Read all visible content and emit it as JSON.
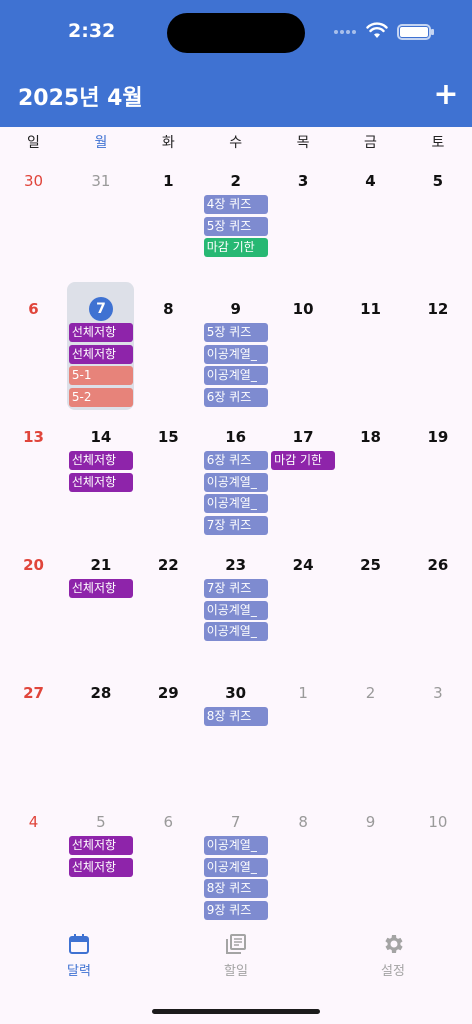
{
  "status": {
    "time": "2:32"
  },
  "header": {
    "title": "2025년 4월",
    "add_label": "+"
  },
  "weekdays": [
    "일",
    "월",
    "화",
    "수",
    "목",
    "금",
    "토"
  ],
  "colors": {
    "quiz": "#7e8bd0",
    "purple": "#8e24aa",
    "green": "#27b873",
    "salmon": "#e7837a",
    "accent": "#3f72d2",
    "sunday": "#e0453b"
  },
  "weeks": [
    {
      "days": [
        {
          "n": "30",
          "other": true,
          "events": []
        },
        {
          "n": "31",
          "other": true,
          "events": []
        },
        {
          "n": "1",
          "events": []
        },
        {
          "n": "2",
          "events": [
            {
              "t": "4장 퀴즈",
              "c": "quiz"
            },
            {
              "t": "5장 퀴즈",
              "c": "quiz"
            },
            {
              "t": "마감 기한",
              "c": "green"
            }
          ]
        },
        {
          "n": "3",
          "events": []
        },
        {
          "n": "4",
          "events": []
        },
        {
          "n": "5",
          "events": []
        }
      ]
    },
    {
      "days": [
        {
          "n": "6",
          "events": []
        },
        {
          "n": "7",
          "today": true,
          "events": [
            {
              "t": "선체저항",
              "c": "purple"
            },
            {
              "t": "선체저항",
              "c": "purple"
            },
            {
              "t": "5-1",
              "c": "salmon"
            },
            {
              "t": "5-2",
              "c": "salmon"
            }
          ]
        },
        {
          "n": "8",
          "events": []
        },
        {
          "n": "9",
          "events": [
            {
              "t": "5장 퀴즈",
              "c": "quiz"
            },
            {
              "t": "이공계열_",
              "c": "quiz"
            },
            {
              "t": "이공계열_",
              "c": "quiz"
            },
            {
              "t": "6장 퀴즈",
              "c": "quiz"
            }
          ]
        },
        {
          "n": "10",
          "events": []
        },
        {
          "n": "11",
          "events": []
        },
        {
          "n": "12",
          "events": []
        }
      ]
    },
    {
      "days": [
        {
          "n": "13",
          "events": []
        },
        {
          "n": "14",
          "events": [
            {
              "t": "선체저항",
              "c": "purple"
            },
            {
              "t": "선체저항",
              "c": "purple"
            }
          ]
        },
        {
          "n": "15",
          "events": []
        },
        {
          "n": "16",
          "events": [
            {
              "t": "6장 퀴즈",
              "c": "quiz"
            },
            {
              "t": "이공계열_",
              "c": "quiz"
            },
            {
              "t": "이공계열_",
              "c": "quiz"
            },
            {
              "t": "7장 퀴즈",
              "c": "quiz"
            }
          ]
        },
        {
          "n": "17",
          "events": [
            {
              "t": "마감 기한",
              "c": "purple"
            }
          ]
        },
        {
          "n": "18",
          "events": []
        },
        {
          "n": "19",
          "events": []
        }
      ]
    },
    {
      "days": [
        {
          "n": "20",
          "events": []
        },
        {
          "n": "21",
          "events": [
            {
              "t": "선체저항",
              "c": "purple"
            }
          ]
        },
        {
          "n": "22",
          "events": []
        },
        {
          "n": "23",
          "events": [
            {
              "t": "7장 퀴즈",
              "c": "quiz"
            },
            {
              "t": "이공계열_",
              "c": "quiz"
            },
            {
              "t": "이공계열_",
              "c": "quiz"
            }
          ]
        },
        {
          "n": "24",
          "events": []
        },
        {
          "n": "25",
          "events": []
        },
        {
          "n": "26",
          "events": []
        }
      ]
    },
    {
      "days": [
        {
          "n": "27",
          "events": []
        },
        {
          "n": "28",
          "events": []
        },
        {
          "n": "29",
          "events": []
        },
        {
          "n": "30",
          "events": [
            {
              "t": "8장 퀴즈",
              "c": "quiz"
            }
          ]
        },
        {
          "n": "1",
          "other": true,
          "events": []
        },
        {
          "n": "2",
          "other": true,
          "events": []
        },
        {
          "n": "3",
          "other": true,
          "events": []
        }
      ]
    },
    {
      "days": [
        {
          "n": "4",
          "other": true,
          "events": []
        },
        {
          "n": "5",
          "other": true,
          "events": [
            {
              "t": "선체저항",
              "c": "purple"
            },
            {
              "t": "선체저항",
              "c": "purple"
            }
          ]
        },
        {
          "n": "6",
          "other": true,
          "events": []
        },
        {
          "n": "7",
          "other": true,
          "events": [
            {
              "t": "이공계열_",
              "c": "quiz"
            },
            {
              "t": "이공계열_",
              "c": "quiz"
            },
            {
              "t": "8장 퀴즈",
              "c": "quiz"
            },
            {
              "t": "9장 퀴즈",
              "c": "quiz"
            }
          ]
        },
        {
          "n": "8",
          "other": true,
          "events": []
        },
        {
          "n": "9",
          "other": true,
          "events": []
        },
        {
          "n": "10",
          "other": true,
          "events": []
        }
      ]
    }
  ],
  "tabs": [
    {
      "label": "달력",
      "icon": "calendar-icon",
      "active": true
    },
    {
      "label": "할일",
      "icon": "library-books-icon",
      "active": false
    },
    {
      "label": "설정",
      "icon": "gear-icon",
      "active": false
    }
  ]
}
